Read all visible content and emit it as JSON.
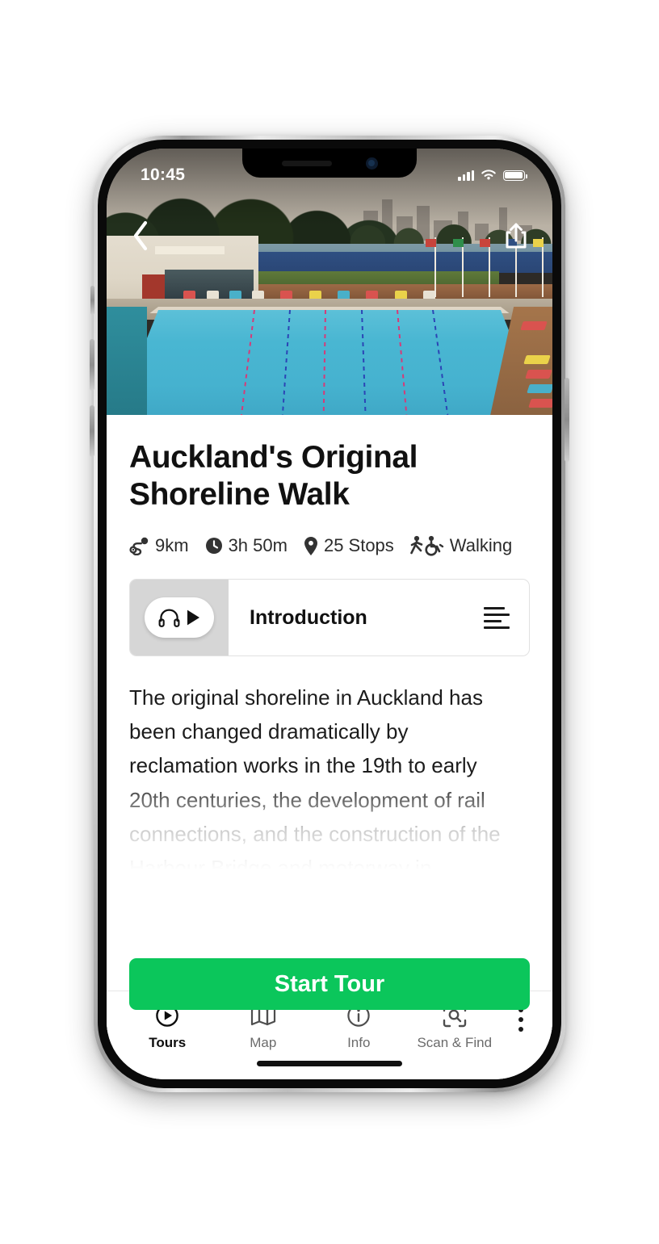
{
  "status_bar": {
    "time": "10:45",
    "cellular_icon": "cellular-bars-icon",
    "wifi_icon": "wifi-icon",
    "battery_icon": "battery-icon"
  },
  "hero": {
    "back_icon": "chevron-left-icon",
    "share_icon": "share-icon",
    "image_alt": "Outdoor swimming pool with lane ropes, deck loungers and city skyline"
  },
  "tour": {
    "title": "Auckland's Original Shoreline Walk",
    "meta": [
      {
        "icon": "route-distance-icon",
        "label": "9km"
      },
      {
        "icon": "clock-icon",
        "label": "3h 50m"
      },
      {
        "icon": "map-pin-icon",
        "label": "25 Stops"
      },
      {
        "icon": "accessibility-walking-icon",
        "label": "Walking"
      }
    ]
  },
  "audio_card": {
    "play_icon": "headphones-play-icon",
    "title": "Introduction",
    "transcript_icon": "transcript-lines-icon"
  },
  "description": {
    "visible_text": "The original shoreline in Auckland has been changed dramatically by reclamation works in the 19th to early 20th centuries, the development of rail connections, and the construction of the Harbour Bridge and motorway in"
  },
  "cta": {
    "label": "Start Tour",
    "color": "#0bc65b"
  },
  "tabbar": {
    "items": [
      {
        "icon": "play-circle-icon",
        "label": "Tours",
        "active": true
      },
      {
        "icon": "map-icon",
        "label": "Map",
        "active": false
      },
      {
        "icon": "info-circle-icon",
        "label": "Info",
        "active": false
      },
      {
        "icon": "scan-find-icon",
        "label": "Scan & Find",
        "active": false
      }
    ],
    "overflow_icon": "kebab-menu-icon"
  },
  "home_indicator": "home-indicator"
}
